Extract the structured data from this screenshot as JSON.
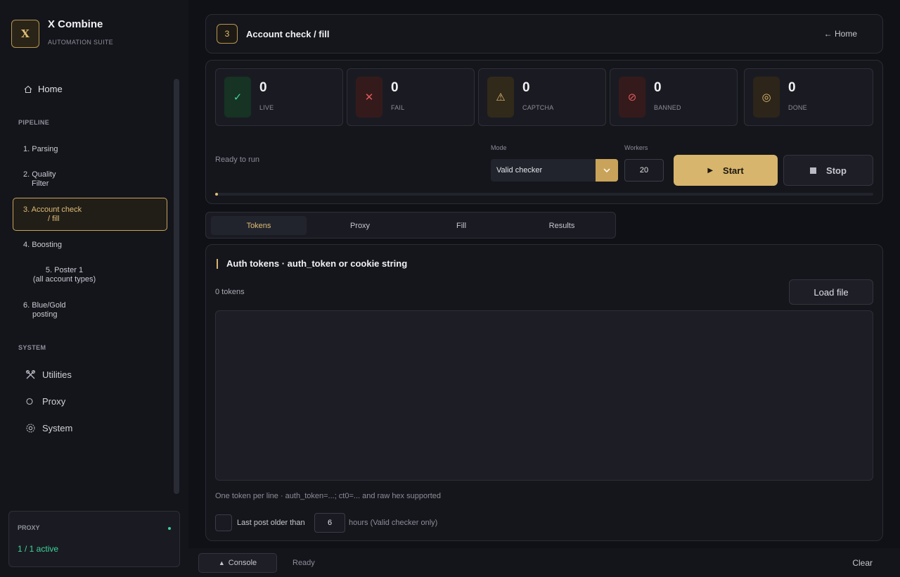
{
  "brand": {
    "logo": "X",
    "name": "X Combine",
    "subtitle": "AUTOMATION SUITE"
  },
  "sidebar": {
    "home_label": "Home",
    "pipeline_label": "PIPELINE",
    "pipeline_items": [
      {
        "label_line1": "1. Parsing",
        "label_line2": ""
      },
      {
        "label_line1": "2. Quality",
        "label_line2": "Filter"
      },
      {
        "label_line1": "3. Account check",
        "label_line2": "/ fill"
      },
      {
        "label_line1": "4. Boosting",
        "label_line2": ""
      },
      {
        "label_line1": "5. Poster 1",
        "label_line2": "(all account types)"
      },
      {
        "label_line1": "6. Blue/Gold",
        "label_line2": "posting"
      }
    ],
    "system_label": "SYSTEM",
    "system_items": [
      {
        "label": "Utilities",
        "icon": "tools-icon"
      },
      {
        "label": "Proxy",
        "icon": "circle-icon"
      },
      {
        "label": "System",
        "icon": "gear-icon"
      }
    ],
    "proxy_box": {
      "label": "PROXY",
      "value": "1 / 1 active",
      "status_color": "#3fd39a"
    }
  },
  "header": {
    "step": "3",
    "title": "Account check / fill",
    "home_link": "← Home"
  },
  "stats": [
    {
      "value": "0",
      "label": "LIVE",
      "icon": "✓",
      "color": "#3fd39a"
    },
    {
      "value": "0",
      "label": "FAIL",
      "icon": "✕",
      "color": "#e05a5a"
    },
    {
      "value": "0",
      "label": "CAPTCHA",
      "icon": "⚠",
      "color": "#e0bd73"
    },
    {
      "value": "0",
      "label": "BANNED",
      "icon": "⊘",
      "color": "#e05a5a"
    },
    {
      "value": "0",
      "label": "DONE",
      "icon": "◎",
      "color": "#e0bd73"
    }
  ],
  "controls": {
    "status_text": "Ready to run",
    "mode_label": "Mode",
    "mode_value": "Valid checker",
    "workers_label": "Workers",
    "workers_value": "20",
    "start_label": "Start",
    "stop_label": "Stop",
    "progress": 0
  },
  "tabs": [
    "Tokens",
    "Proxy",
    "Fill",
    "Results"
  ],
  "tokens_panel": {
    "title": "Auth tokens · auth_token or cookie string",
    "count": "0 tokens",
    "load_button": "Load file",
    "textarea_value": "",
    "hint": "One token per line · auth_token=...; ct0=... and raw hex supported",
    "checkbox_label": "Last post older than",
    "hours_value": "6",
    "hours_suffix": "hours (Valid checker only)"
  },
  "footer": {
    "console_label": "Console",
    "status": "Ready",
    "clear_label": "Clear"
  },
  "colors": {
    "accent": "#d8b56c",
    "success": "#3fd39a",
    "danger": "#e05a5a"
  }
}
